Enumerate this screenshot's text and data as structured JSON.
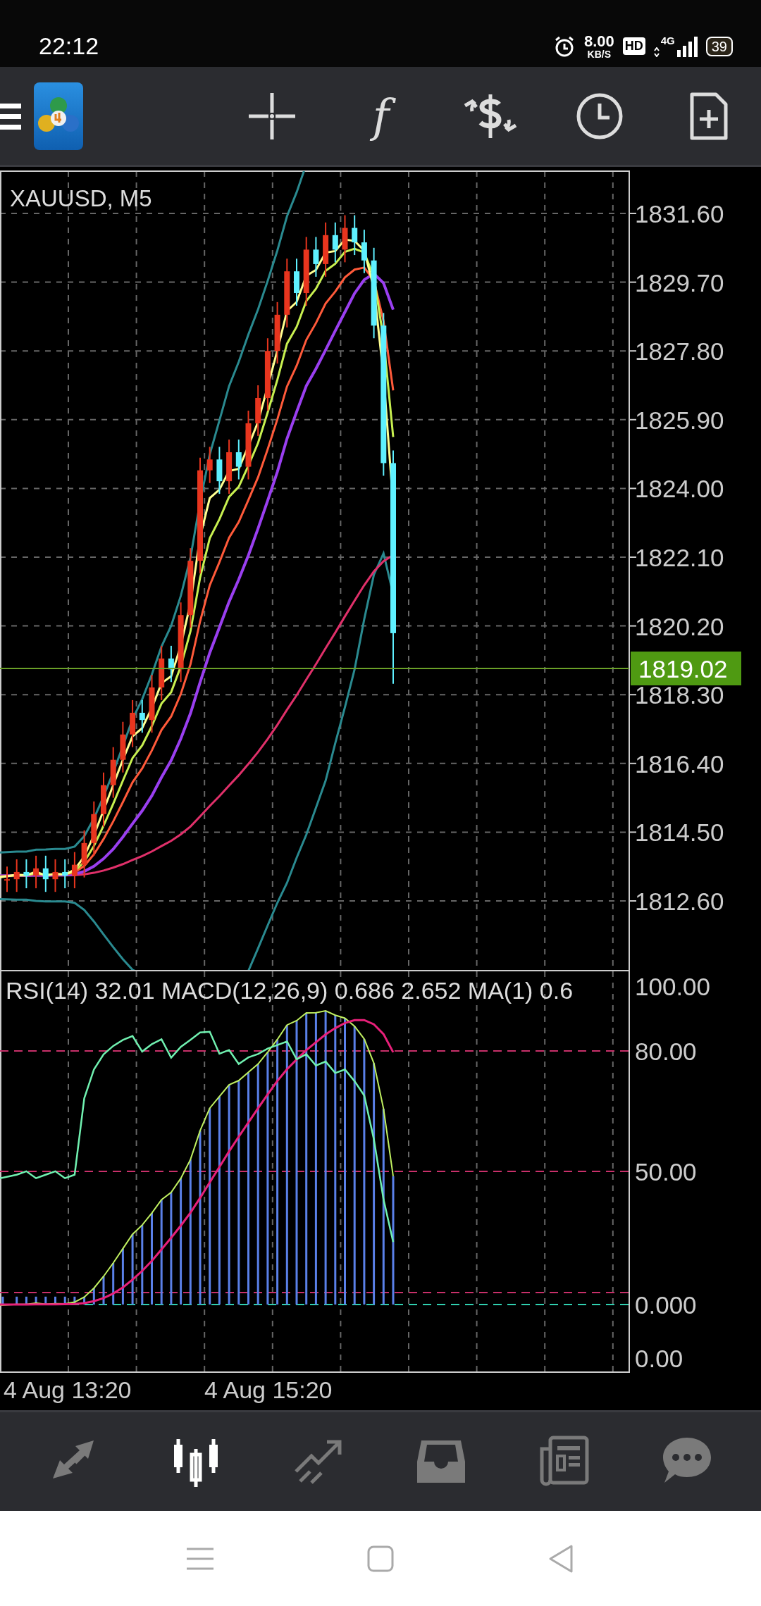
{
  "status_bar": {
    "time": "22:12",
    "net_speed": "8.00",
    "net_unit": "KB/S",
    "hd": "HD",
    "network": "4G",
    "battery": "39"
  },
  "toolbar": {
    "function_glyph": "f"
  },
  "chart": {
    "title": "XAUUSD, M5",
    "price_axis": [
      "1831.60",
      "1829.70",
      "1827.80",
      "1825.90",
      "1824.00",
      "1822.10",
      "1820.20",
      "1818.30",
      "1816.40",
      "1814.50",
      "1812.60"
    ],
    "current_price": "1819.02"
  },
  "indicator": {
    "legend": "RSI(14) 32.01 MACD(12,26,9) 0.686 2.652 MA(1) 0.6",
    "axis": [
      "100.00",
      "80.00",
      "50.00",
      "0.000",
      "0.00"
    ]
  },
  "time_axis": [
    "4 Aug 13:20",
    "4 Aug 15:20"
  ],
  "bottom_nav": [
    {
      "kind": "quotes",
      "selected": false
    },
    {
      "kind": "chart",
      "selected": true
    },
    {
      "kind": "trade",
      "selected": false
    },
    {
      "kind": "history",
      "selected": false
    },
    {
      "kind": "news",
      "selected": false
    },
    {
      "kind": "chat",
      "selected": false
    }
  ]
}
